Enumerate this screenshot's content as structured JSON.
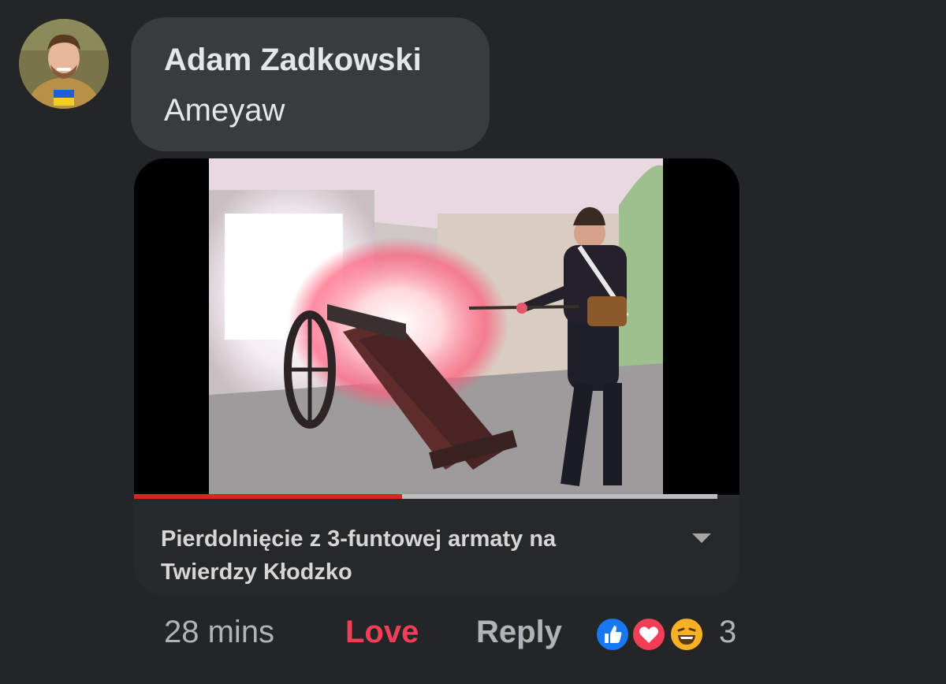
{
  "comment": {
    "author": "Adam Zadkowski",
    "text": "Ameyaw"
  },
  "video": {
    "title_line1": "Pierdolnięcie z 3-funtowej armaty na",
    "title_line2": "Twierdzy Kłodzko",
    "progress_fraction": 0.46
  },
  "actions": {
    "timestamp": "28 mins",
    "love_label": "Love",
    "reply_label": "Reply",
    "reaction_count": "3",
    "reactions": [
      "like-icon",
      "love-icon",
      "haha-icon"
    ]
  },
  "colors": {
    "background": "#242526",
    "bubble": "#3a3b3c",
    "love": "#f33e58",
    "like": "#1877f2",
    "progress": "#d8261f"
  }
}
